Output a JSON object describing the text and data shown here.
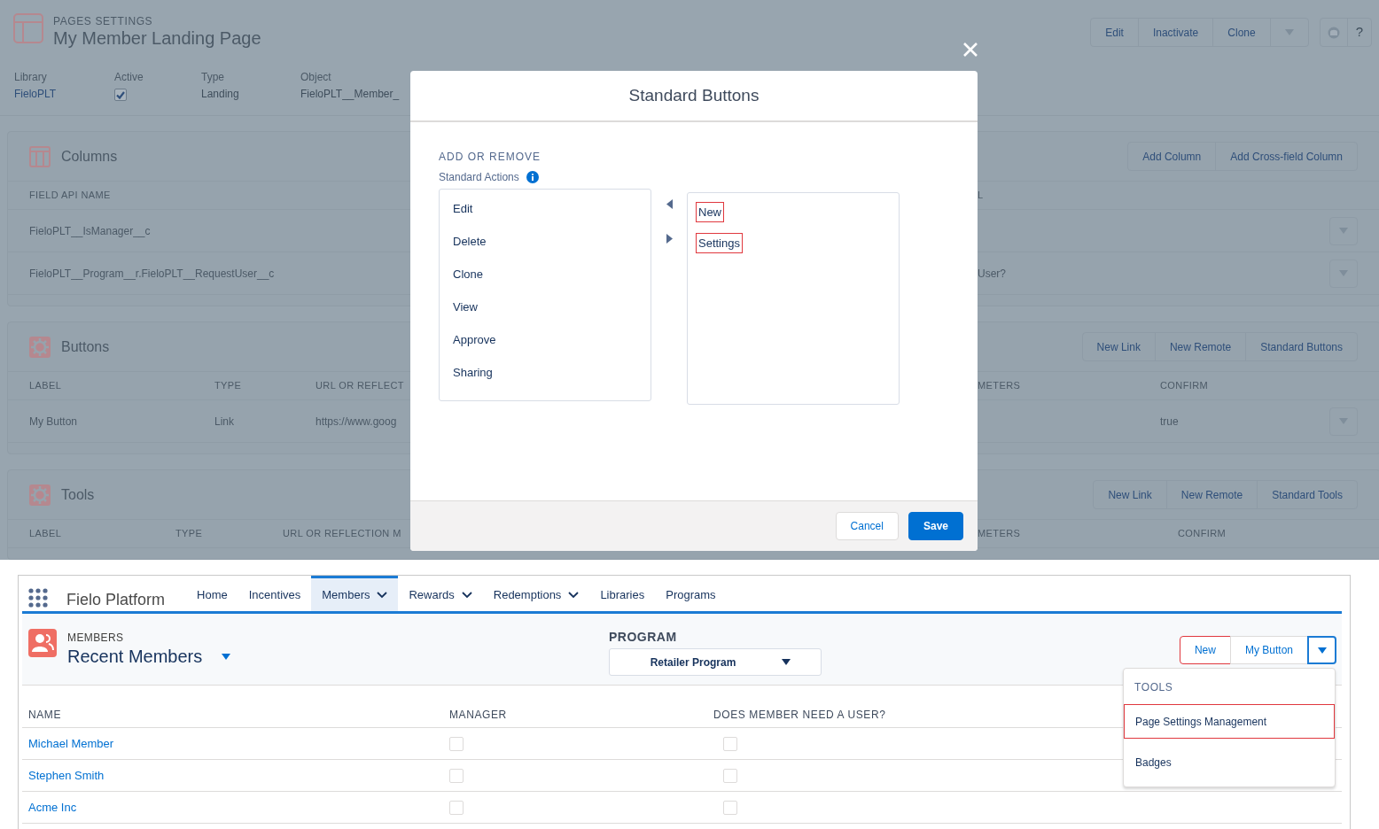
{
  "page_header": {
    "eyebrow": "PAGES SETTINGS",
    "title": "My Member Landing Page",
    "actions": [
      "Edit",
      "Inactivate",
      "Clone"
    ],
    "help_label": "?"
  },
  "details": [
    {
      "label": "Library",
      "value": "FieloPLT",
      "kind": "link"
    },
    {
      "label": "Active",
      "checked": true,
      "kind": "checkbox"
    },
    {
      "label": "Type",
      "value": "Landing",
      "kind": "text"
    },
    {
      "label": "Object",
      "value": "FieloPLT__Member_",
      "kind": "text"
    }
  ],
  "sections": [
    {
      "title": "Columns",
      "kind": "columns",
      "actions": [
        "Add Column",
        "Add Cross-field Column"
      ],
      "columns": [
        "FIELD API NAME",
        "L"
      ],
      "rows": [
        {
          "cells": [
            "FieloPLT__IsManager__c",
            null
          ]
        },
        {
          "cells": [
            "FieloPLT__Program__r.FieloPLT__RequestUser__c",
            "User?"
          ]
        }
      ]
    },
    {
      "title": "Buttons",
      "kind": "actions",
      "actions": [
        "New Link",
        "New Remote",
        "Standard Buttons"
      ],
      "columns": [
        "LABEL",
        "TYPE",
        "URL OR REFLECT",
        "METERS",
        "CONFIRM"
      ],
      "rows": [
        {
          "cells": [
            "My Button",
            "Link",
            "https://www.goog",
            null,
            "true"
          ]
        }
      ]
    },
    {
      "title": "Tools",
      "kind": "actions",
      "actions": [
        "New Link",
        "New Remote",
        "Standard Tools"
      ],
      "columns": [
        "LABEL",
        "TYPE",
        "URL OR REFLECTION M",
        "METERS",
        "CONFIRM"
      ]
    }
  ],
  "modal": {
    "title": "Standard Buttons",
    "section_label": "ADD OR REMOVE",
    "field_label": "Standard Actions",
    "available": [
      {
        "label": "Edit"
      },
      {
        "label": "Delete"
      },
      {
        "label": "Clone"
      },
      {
        "label": "View"
      },
      {
        "label": "Approve"
      },
      {
        "label": "Sharing"
      }
    ],
    "chosen": [
      {
        "label": "New",
        "highlighted": true
      },
      {
        "label": "Settings",
        "highlighted": true
      }
    ],
    "buttons": [
      {
        "label": "Cancel",
        "kind": "neutral"
      },
      {
        "label": "Save",
        "kind": "brand"
      }
    ]
  },
  "app": {
    "name": "Fielo Platform",
    "nav": [
      {
        "label": "Home",
        "selected": false,
        "has_menu": false
      },
      {
        "label": "Incentives",
        "selected": false,
        "has_menu": false
      },
      {
        "label": "Members",
        "selected": true,
        "has_menu": true
      },
      {
        "label": "Rewards",
        "selected": false,
        "has_menu": true
      },
      {
        "label": "Redemptions",
        "selected": false,
        "has_menu": true
      },
      {
        "label": "Libraries",
        "selected": false,
        "has_menu": false
      },
      {
        "label": "Programs",
        "selected": false,
        "has_menu": false
      }
    ],
    "list_header": {
      "object": "MEMBERS",
      "view": "Recent Members"
    },
    "program": {
      "label": "PROGRAM",
      "value": "Retailer Program"
    },
    "buttons": [
      {
        "label": "New",
        "highlighted": true
      },
      {
        "label": "My Button",
        "highlighted": false
      }
    ],
    "menu": {
      "expanded": true,
      "heading": "TOOLS",
      "items": [
        {
          "label": "Page Settings Management",
          "highlighted": true
        },
        {
          "label": "Badges",
          "highlighted": false
        }
      ]
    },
    "table": {
      "columns": [
        "NAME",
        "MANAGER",
        "DOES MEMBER NEED A USER?"
      ],
      "rows": [
        {
          "name": "Michael Member",
          "manager": false,
          "needs_user": false
        },
        {
          "name": "Stephen Smith",
          "manager": false,
          "needs_user": false
        },
        {
          "name": "Acme Inc",
          "manager": false,
          "needs_user": false
        }
      ]
    }
  }
}
